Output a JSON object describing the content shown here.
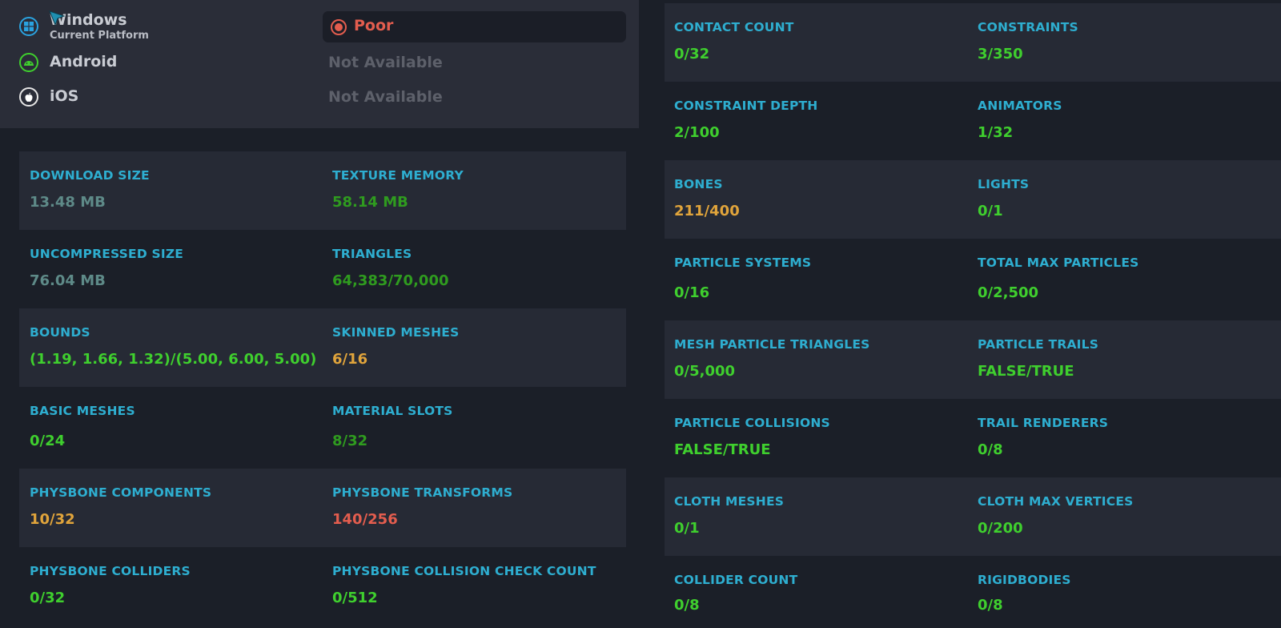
{
  "platforms": {
    "rows": [
      {
        "name": "Windows",
        "sub": "Current Platform",
        "icon": "windows-icon",
        "status": "Poor",
        "status_color": "#e35d4e"
      },
      {
        "name": "Android",
        "sub": "",
        "icon": "android-icon",
        "status": "Not Available",
        "status_color": "#5d606a"
      },
      {
        "name": "iOS",
        "sub": "",
        "icon": "apple-icon",
        "status": "Not Available",
        "status_color": "#5d606a"
      }
    ]
  },
  "colors": {
    "label": "#2eaed0",
    "green": "#3fcf2e",
    "dark_green": "#2f9b1f",
    "gray": "#5e8a88",
    "orange": "#e0a43b",
    "red": "#e35d4e"
  },
  "left_stats": [
    {
      "label": "DOWNLOAD SIZE",
      "value": "13.48 MB",
      "color": "gray"
    },
    {
      "label": "TEXTURE MEMORY",
      "value": "58.14 MB",
      "color": "dark_green"
    },
    {
      "label": "UNCOMPRESSED SIZE",
      "value": "76.04 MB",
      "color": "gray"
    },
    {
      "label": "TRIANGLES",
      "value": "64,383/70,000",
      "color": "dark_green"
    },
    {
      "label": "BOUNDS",
      "value": "(1.19, 1.66, 1.32)/(5.00, 6.00, 5.00)",
      "color": "green"
    },
    {
      "label": "SKINNED MESHES",
      "value": "6/16",
      "color": "orange"
    },
    {
      "label": "BASIC MESHES",
      "value": "0/24",
      "color": "green"
    },
    {
      "label": "MATERIAL SLOTS",
      "value": "8/32",
      "color": "dark_green"
    },
    {
      "label": "PHYSBONE COMPONENTS",
      "value": "10/32",
      "color": "orange"
    },
    {
      "label": "PHYSBONE TRANSFORMS",
      "value": "140/256",
      "color": "red"
    },
    {
      "label": "PHYSBONE COLLIDERS",
      "value": "0/32",
      "color": "green"
    },
    {
      "label": "PHYSBONE COLLISION CHECK COUNT",
      "value": "0/512",
      "color": "green"
    }
  ],
  "right_stats": [
    {
      "label": "CONTACT COUNT",
      "value": "0/32",
      "color": "green"
    },
    {
      "label": "CONSTRAINTS",
      "value": "3/350",
      "color": "green"
    },
    {
      "label": "CONSTRAINT DEPTH",
      "value": "2/100",
      "color": "green"
    },
    {
      "label": "ANIMATORS",
      "value": "1/32",
      "color": "green"
    },
    {
      "label": "BONES",
      "value": "211/400",
      "color": "orange"
    },
    {
      "label": "LIGHTS",
      "value": "0/1",
      "color": "green"
    },
    {
      "label": "PARTICLE SYSTEMS",
      "value": "0/16",
      "color": "green"
    },
    {
      "label": "TOTAL MAX PARTICLES",
      "value": "0/2,500",
      "color": "green"
    },
    {
      "label": "MESH PARTICLE TRIANGLES",
      "value": "0/5,000",
      "color": "green"
    },
    {
      "label": "PARTICLE TRAILS",
      "value": "FALSE/TRUE",
      "color": "green"
    },
    {
      "label": "PARTICLE COLLISIONS",
      "value": "FALSE/TRUE",
      "color": "green"
    },
    {
      "label": "TRAIL RENDERERS",
      "value": "0/8",
      "color": "green"
    },
    {
      "label": "CLOTH MESHES",
      "value": "0/1",
      "color": "green"
    },
    {
      "label": "CLOTH MAX VERTICES",
      "value": "0/200",
      "color": "green"
    },
    {
      "label": "COLLIDER COUNT",
      "value": "0/8",
      "color": "green"
    },
    {
      "label": "RIGIDBODIES",
      "value": "0/8",
      "color": "green"
    }
  ]
}
